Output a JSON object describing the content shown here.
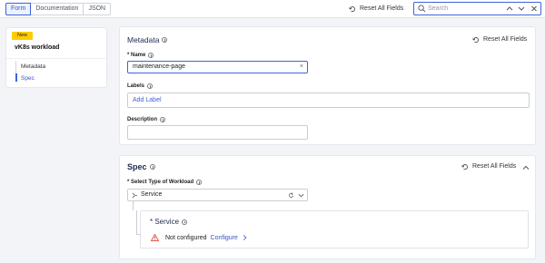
{
  "topbar": {
    "tabs": [
      {
        "label": "Form",
        "active": true
      },
      {
        "label": "Documentation",
        "active": false
      },
      {
        "label": "JSON",
        "active": false
      }
    ],
    "reset_all_label": "Reset All Fields",
    "search": {
      "placeholder": "Search",
      "value": ""
    }
  },
  "sidebar": {
    "badge": "New",
    "title": "vK8s workload",
    "items": [
      {
        "label": "Metadata",
        "active": false
      },
      {
        "label": "Spec",
        "active": true
      }
    ]
  },
  "metadata": {
    "title": "Metadata",
    "reset_label": "Reset All Fields",
    "name_label": "* Name",
    "name_value": "maintenance-page",
    "labels_label": "Labels",
    "labels_placeholder": "Add Label",
    "description_label": "Description",
    "description_value": ""
  },
  "spec": {
    "title": "Spec",
    "reset_label": "Reset All Fields",
    "workload_label": "* Select Type of Workload",
    "workload_value": "Service",
    "service_label": "* Service",
    "status_text": "Not configured",
    "configure_label": "Configure"
  },
  "colors": {
    "accent": "#3f63d9",
    "badge": "#ffcc00",
    "warning": "#e0453a"
  },
  "icons": [
    "reset-icon",
    "search-icon",
    "chevron-up-icon",
    "chevron-down-icon",
    "close-icon",
    "info-icon",
    "warning-icon",
    "chevron-right-icon",
    "refresh-icon",
    "service-icon"
  ]
}
